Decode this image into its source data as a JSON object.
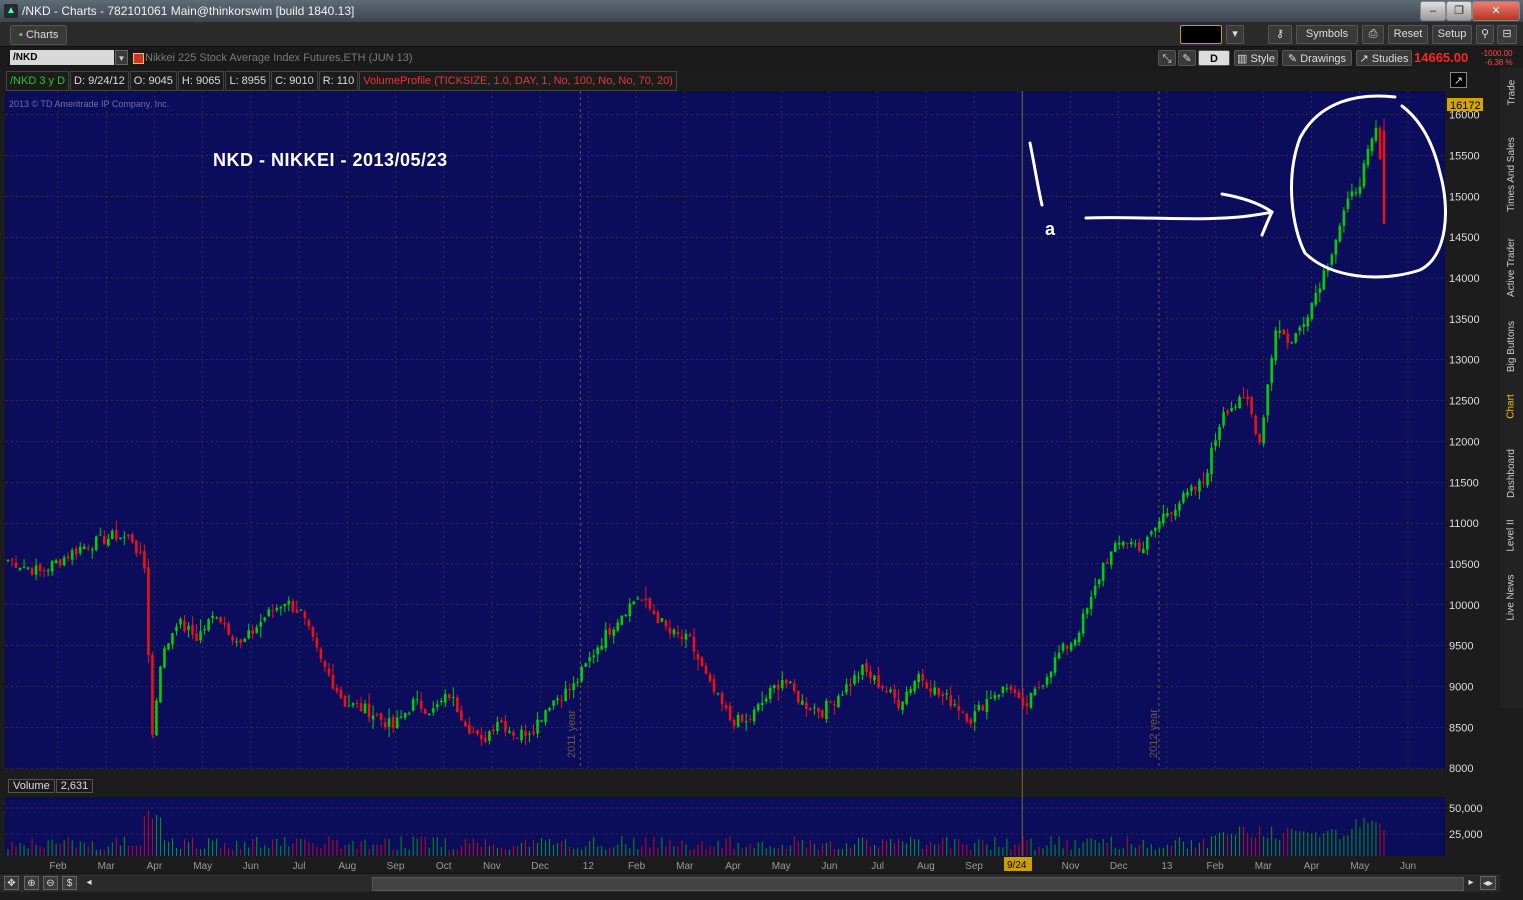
{
  "window": {
    "title": "/NKD - Charts - 782101061 Main@thinkorswim [build 1840.13]",
    "buttons": [
      "–",
      "❐",
      "✕"
    ]
  },
  "toolbar": {
    "tab": "Charts",
    "symbols_label": "Symbols",
    "reset_label": "Reset",
    "setup_label": "Setup"
  },
  "symbol_bar": {
    "symbol": "/NKD",
    "description": "Nikkei 225 Stock Average Index Futures,ETH (JUN 13)",
    "aggregation": "D",
    "style_label": "Style",
    "drawings_label": "Drawings",
    "studies_label": "Studies",
    "last_price": "14665.00",
    "change": "-1000.00",
    "change_pct": "-6.38 %"
  },
  "study_bar": {
    "chart_label": "/NKD 3 y D",
    "date": "D: 9/24/12",
    "open": "O: 9045",
    "high": "H: 9065",
    "low": "L: 8955",
    "close": "C: 9010",
    "range": "R: 110",
    "study": "VolumeProfile (TICKSIZE, 1.0, DAY, 1, No, 100, No, No, 70, 20)"
  },
  "copyright": "2013 © TD Ameritrade IP Company, Inc.",
  "annotation": {
    "title": "NKD  -  NIKKEI  -  2013/05/23",
    "letter": "a"
  },
  "price_badge": "16172",
  "volume_panel": {
    "label": "Volume",
    "value": "2,631"
  },
  "sidebar_tabs": [
    "Trade",
    "Times And Sales",
    "Active Trader",
    "Big Buttons",
    "Chart",
    "Dashboard",
    "Level II",
    "Live News"
  ],
  "colors": {
    "background": "#0c0c5c",
    "up": "#00d000",
    "down": "#ee1111",
    "grid": "#5a4a2a",
    "cursor": "#c8a000"
  },
  "chart_data": {
    "type": "candlestick",
    "title": "",
    "y_ticks": [
      16000,
      15500,
      15000,
      14500,
      14000,
      13500,
      13000,
      12500,
      12000,
      11500,
      11000,
      10500,
      10000,
      9500,
      9000,
      8500,
      8000
    ],
    "ylim": [
      7990,
      16290
    ],
    "volume_ticks": [
      "50,000",
      "25,000"
    ],
    "x_ticks": [
      "Feb",
      "Mar",
      "Apr",
      "May",
      "Jun",
      "Jul",
      "Aug",
      "Sep",
      "Oct",
      "Nov",
      "Dec",
      "12",
      "Feb",
      "Mar",
      "Apr",
      "May",
      "Jun",
      "Jul",
      "Aug",
      "Sep",
      "9/24",
      "Nov",
      "Dec",
      "13",
      "Feb",
      "Mar",
      "Apr",
      "May",
      "Jun"
    ],
    "period_labels": [
      "2011 year",
      "2012 year"
    ],
    "series": [
      {
        "keypoints": [
          [
            0,
            10550
          ],
          [
            8,
            10400
          ],
          [
            18,
            10700
          ],
          [
            27,
            10850
          ],
          [
            31,
            10800
          ],
          [
            34,
            10450
          ],
          [
            36,
            8400
          ],
          [
            38,
            9300
          ],
          [
            42,
            9800
          ],
          [
            47,
            9600
          ],
          [
            52,
            9900
          ],
          [
            58,
            9500
          ],
          [
            64,
            9850
          ],
          [
            69,
            10050
          ],
          [
            73,
            9900
          ],
          [
            78,
            9300
          ],
          [
            84,
            8800
          ],
          [
            90,
            8700
          ],
          [
            96,
            8500
          ],
          [
            101,
            8800
          ],
          [
            106,
            8700
          ],
          [
            110,
            8900
          ],
          [
            115,
            8500
          ],
          [
            118,
            8300
          ],
          [
            122,
            8600
          ],
          [
            127,
            8400
          ],
          [
            131,
            8500
          ],
          [
            135,
            8800
          ],
          [
            141,
            9000
          ],
          [
            147,
            9500
          ],
          [
            153,
            9900
          ],
          [
            157,
            10100
          ],
          [
            161,
            9900
          ],
          [
            165,
            9650
          ],
          [
            170,
            9550
          ],
          [
            175,
            9000
          ],
          [
            180,
            8600
          ],
          [
            184,
            8550
          ],
          [
            188,
            8800
          ],
          [
            193,
            9100
          ],
          [
            198,
            8800
          ],
          [
            203,
            8700
          ],
          [
            208,
            8950
          ],
          [
            213,
            9200
          ],
          [
            218,
            9000
          ],
          [
            222,
            8800
          ],
          [
            227,
            9150
          ],
          [
            232,
            8900
          ],
          [
            236,
            8800
          ],
          [
            240,
            8600
          ],
          [
            245,
            8900
          ],
          [
            250,
            9000
          ],
          [
            253,
            8700
          ],
          [
            257,
            9000
          ],
          [
            262,
            9400
          ],
          [
            266,
            9600
          ],
          [
            270,
            10050
          ],
          [
            273,
            10500
          ],
          [
            278,
            10800
          ],
          [
            283,
            10700
          ],
          [
            288,
            11100
          ],
          [
            293,
            11300
          ],
          [
            298,
            11500
          ],
          [
            303,
            12400
          ],
          [
            309,
            12500
          ],
          [
            312,
            12000
          ],
          [
            316,
            13400
          ],
          [
            320,
            13200
          ],
          [
            325,
            13700
          ],
          [
            329,
            14200
          ],
          [
            333,
            14800
          ],
          [
            337,
            15200
          ],
          [
            341,
            15800
          ],
          [
            343,
            15100
          ]
        ],
        "last": {
          "open": 15800,
          "high": 15950,
          "low": 14665,
          "close": 14665
        }
      }
    ]
  }
}
